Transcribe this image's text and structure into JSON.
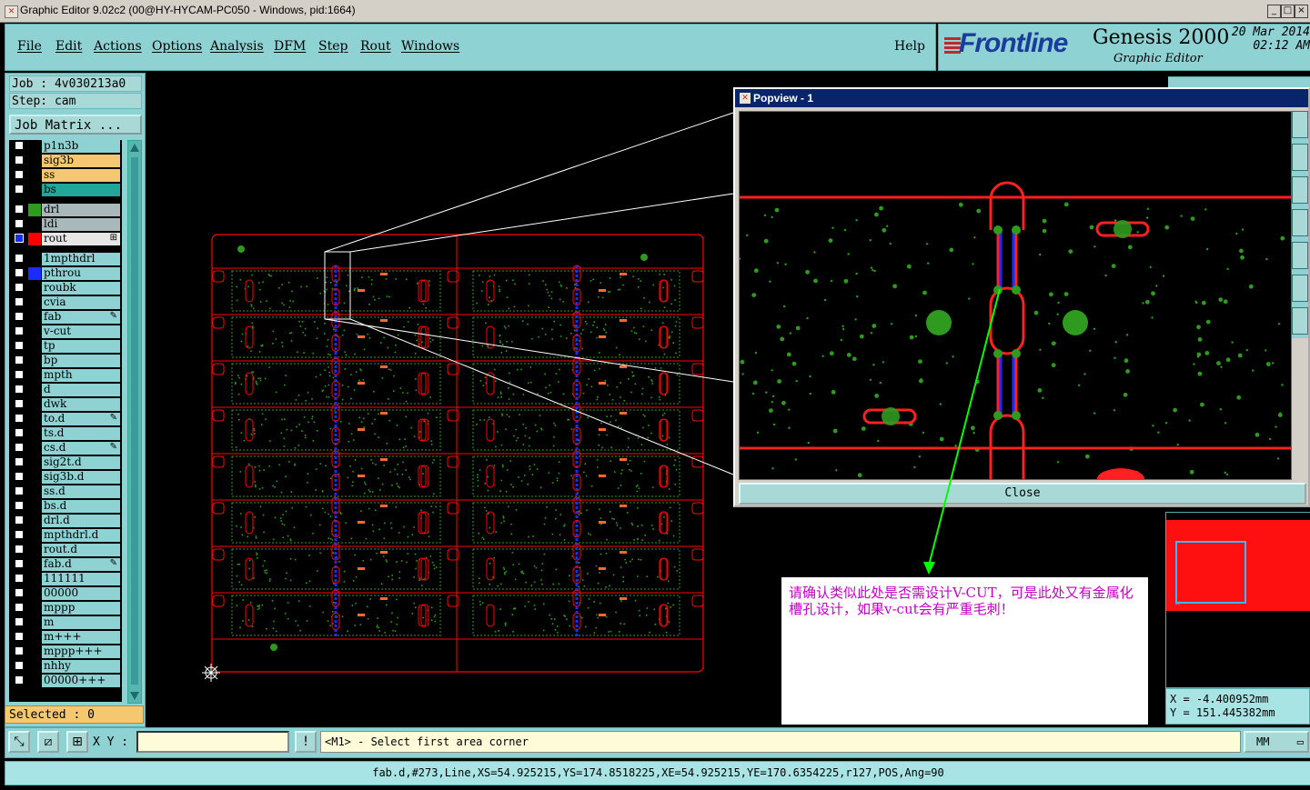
{
  "window": {
    "title": "Graphic Editor 9.02c2 (00@HY-HYCAM-PC050 - Windows, pid:1664)",
    "controls": [
      "_",
      "□",
      "×"
    ]
  },
  "menu": {
    "items": [
      "File",
      "Edit",
      "Actions",
      "Options",
      "Analysis",
      "DFM",
      "Step",
      "Rout",
      "Windows"
    ],
    "help": "Help"
  },
  "brand": {
    "logo": "Frontline",
    "product": "Genesis 2000",
    "subtitle": "Graphic Editor",
    "date": "20 Mar 2014",
    "time": "02:12 AM"
  },
  "job": {
    "job_line": "Job : 4v030213a0",
    "step_line": "Step: cam",
    "matrix_button": "Job Matrix ..."
  },
  "layers": [
    {
      "name": "p1n3b",
      "swatch": "#000000",
      "bg": "#8ed2d4"
    },
    {
      "name": "sig3b",
      "swatch": "#000000",
      "bg": "#f4c870"
    },
    {
      "name": "ss",
      "swatch": "#000000",
      "bg": "#f4c870"
    },
    {
      "name": "bs",
      "swatch": "#000000",
      "bg": "#1fa89a"
    },
    {
      "name": "drl",
      "swatch": "#2e9a1e",
      "bg": "#a9b9bb"
    },
    {
      "name": "ldi",
      "swatch": "#000000",
      "bg": "#a9b9bb"
    },
    {
      "name": "rout",
      "swatch": "#ff0000",
      "bg": "#e6e6e6",
      "active": true,
      "mark": "⊞"
    },
    {
      "name": "1mpthdrl",
      "swatch": "#000000",
      "bg": "#8ed2d4"
    },
    {
      "name": "pthrou",
      "swatch": "#1a2cff",
      "bg": "#8ed2d4"
    },
    {
      "name": "roubk",
      "swatch": "#000000",
      "bg": "#8ed2d4"
    },
    {
      "name": "cvia",
      "swatch": "#000000",
      "bg": "#8ed2d4"
    },
    {
      "name": "fab",
      "swatch": "#000000",
      "bg": "#8ed2d4",
      "mark": "✎"
    },
    {
      "name": "v-cut",
      "swatch": "#000000",
      "bg": "#8ed2d4"
    },
    {
      "name": "tp",
      "swatch": "#000000",
      "bg": "#8ed2d4"
    },
    {
      "name": "bp",
      "swatch": "#000000",
      "bg": "#8ed2d4"
    },
    {
      "name": "mpth",
      "swatch": "#000000",
      "bg": "#8ed2d4"
    },
    {
      "name": "d",
      "swatch": "#000000",
      "bg": "#8ed2d4"
    },
    {
      "name": "dwk",
      "swatch": "#000000",
      "bg": "#8ed2d4"
    },
    {
      "name": "to.d",
      "swatch": "#000000",
      "bg": "#8ed2d4",
      "mark": "✎"
    },
    {
      "name": "ts.d",
      "swatch": "#000000",
      "bg": "#8ed2d4"
    },
    {
      "name": "cs.d",
      "swatch": "#000000",
      "bg": "#8ed2d4",
      "mark": "✎"
    },
    {
      "name": "sig2t.d",
      "swatch": "#000000",
      "bg": "#8ed2d4"
    },
    {
      "name": "sig3b.d",
      "swatch": "#000000",
      "bg": "#8ed2d4"
    },
    {
      "name": "ss.d",
      "swatch": "#000000",
      "bg": "#8ed2d4"
    },
    {
      "name": "bs.d",
      "swatch": "#000000",
      "bg": "#8ed2d4"
    },
    {
      "name": "drl.d",
      "swatch": "#000000",
      "bg": "#8ed2d4"
    },
    {
      "name": "mpthdrl.d",
      "swatch": "#000000",
      "bg": "#8ed2d4"
    },
    {
      "name": "rout.d",
      "swatch": "#000000",
      "bg": "#8ed2d4"
    },
    {
      "name": "fab.d",
      "swatch": "#000000",
      "bg": "#8ed2d4",
      "mark": "✎"
    },
    {
      "name": "111111",
      "swatch": "#000000",
      "bg": "#8ed2d4"
    },
    {
      "name": "00000",
      "swatch": "#000000",
      "bg": "#8ed2d4"
    },
    {
      "name": "mppp",
      "swatch": "#000000",
      "bg": "#8ed2d4"
    },
    {
      "name": "m",
      "swatch": "#000000",
      "bg": "#8ed2d4"
    },
    {
      "name": "m+++",
      "swatch": "#000000",
      "bg": "#8ed2d4"
    },
    {
      "name": "mppp+++",
      "swatch": "#000000",
      "bg": "#8ed2d4"
    },
    {
      "name": "nhhy",
      "swatch": "#000000",
      "bg": "#8ed2d4"
    },
    {
      "name": "00000+++",
      "swatch": "#000000",
      "bg": "#8ed2d4"
    }
  ],
  "selected": "Selected : 0",
  "command": {
    "xy_label": "X Y :",
    "xy_value": "",
    "prompt": "<M1> - Select first area corner",
    "units": "MM",
    "alert_icon": "!"
  },
  "status": "fab.d,#273,Line,XS=54.925215,YS=174.8518225,XE=54.925215,YE=170.6354225,r127,POS,Ang=90",
  "popview": {
    "title": "Popview - 1",
    "close": "Close"
  },
  "coords": {
    "x": "X = -4.400952mm",
    "y": "Y = 151.445382mm"
  },
  "note": "请确认类似此处是否需设计V-CUT，可是此处又有金属化槽孔设计，如果v-cut会有严重毛刺！",
  "colors": {
    "panel": "#8ed2d4",
    "board_outline": "#ff0000",
    "copper": "#2e9a1e",
    "vcut": "#1a2cff",
    "annotation_arrow": "#00ff00",
    "note_text": "#c800c8"
  }
}
